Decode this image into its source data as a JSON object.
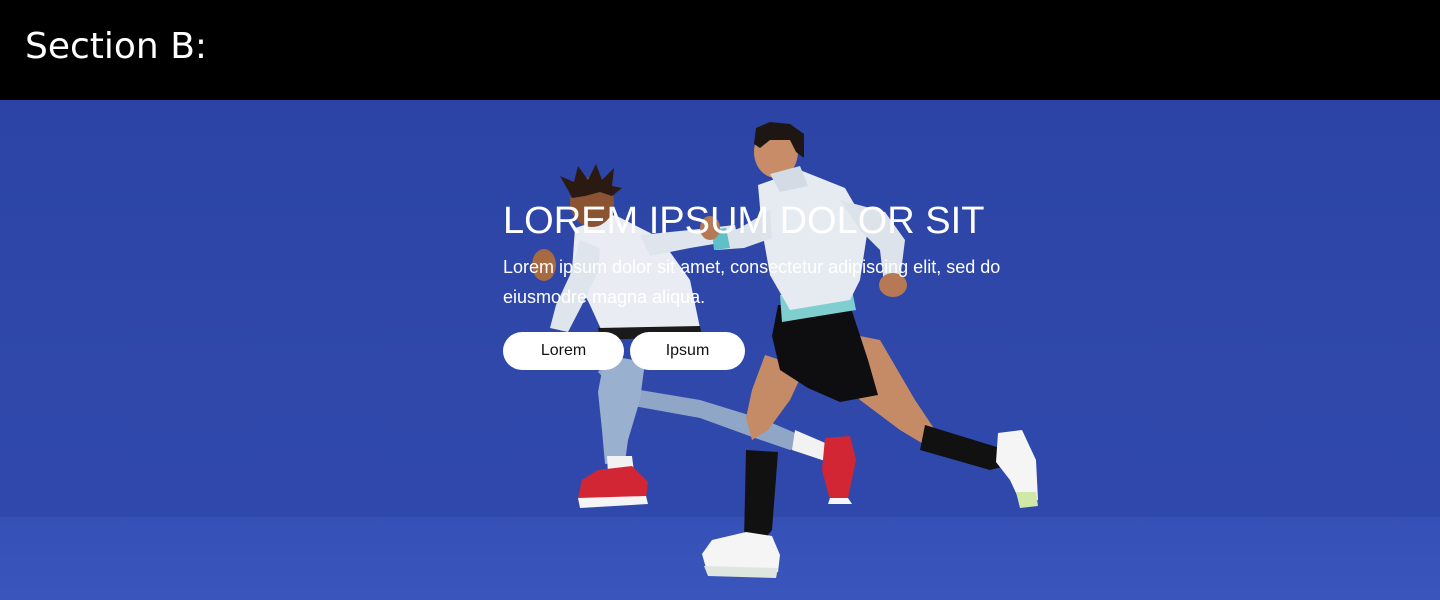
{
  "section": {
    "title": "Section B:"
  },
  "hero": {
    "headline": "LOREM IPSUM DOLOR SIT",
    "body": "Lorem ipsum dolor sit amet, consectetur adipiscing elit, sed do eiusmodre magna aliqua.",
    "background_color": "#2f48aa",
    "image": "runners-photo",
    "buttons": {
      "primary_label": "Lorem",
      "secondary_label": "Ipsum"
    }
  }
}
